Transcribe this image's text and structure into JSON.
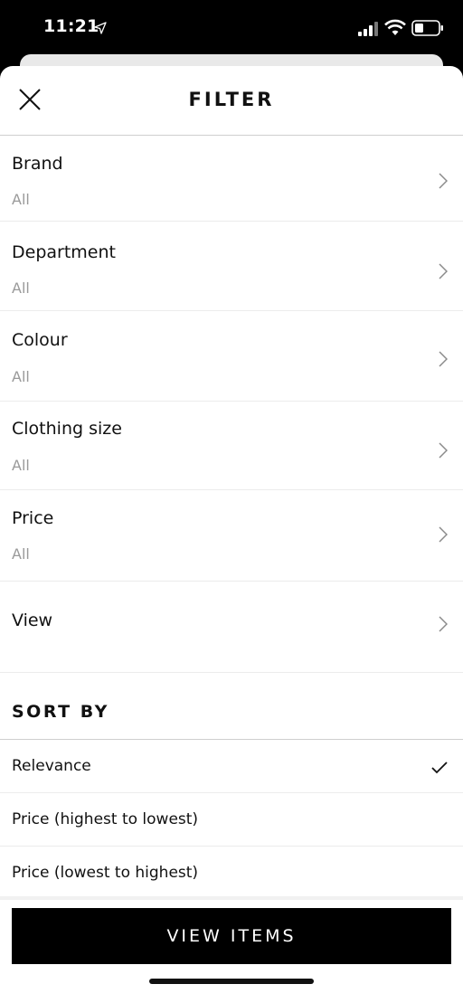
{
  "status_bar": {
    "time": "11:21",
    "icons": [
      "location-arrow-icon",
      "cellular-signal-icon",
      "wifi-icon",
      "battery-icon"
    ]
  },
  "header": {
    "title": "FILTER",
    "close_icon": "close-icon"
  },
  "filters": [
    {
      "label": "Brand",
      "value": "All"
    },
    {
      "label": "Department",
      "value": "All"
    },
    {
      "label": "Colour",
      "value": "All"
    },
    {
      "label": "Clothing size",
      "value": "All"
    },
    {
      "label": "Price",
      "value": "All"
    },
    {
      "label": "View",
      "value": ""
    }
  ],
  "sort": {
    "title": "SORT BY",
    "options": [
      {
        "label": "Relevance",
        "selected": true
      },
      {
        "label": "Price (highest to lowest)",
        "selected": false
      },
      {
        "label": "Price (lowest to highest)",
        "selected": false
      }
    ]
  },
  "footer": {
    "button_label": "VIEW ITEMS"
  },
  "colors": {
    "primary": "#000000",
    "background": "#ffffff",
    "muted_text": "#9a9a9a"
  }
}
